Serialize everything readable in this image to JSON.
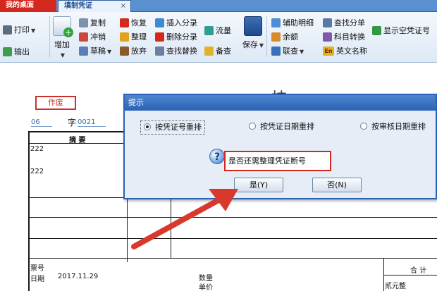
{
  "tabs": {
    "desktop": "我的桌面",
    "voucher": "填制凭证",
    "close_glyph": "×"
  },
  "toolbar": {
    "print": "打印",
    "export": "输出",
    "add": "增加",
    "copy": "复制",
    "reverse": "冲销",
    "draft": "草稿",
    "restore": "恢复",
    "organize": "整理",
    "discard": "放弃",
    "insert_entry": "插入分录",
    "delete_entry": "删除分录",
    "find_replace": "查找替换",
    "cashflow": "流量",
    "memo": "备查",
    "save": "保存",
    "aux_detail": "辅助明细",
    "balance": "余额",
    "linked_query": "联查",
    "find_entry": "查找分单",
    "subject_convert": "科目转换",
    "english_name": "英文名称",
    "show_empty_no": "显示空凭证号",
    "english_badge": "En"
  },
  "voucher": {
    "status": "作废",
    "title_partial": "技",
    "date_fragment": "06",
    "word_label": "字",
    "number": "0021",
    "summary_header": "摘 要",
    "rows": [
      "222",
      "222"
    ],
    "ticket_no_label": "票号",
    "date_label": "日期",
    "date_value": "2017.11.29",
    "quantity_label": "数量",
    "unit_price_label": "单价",
    "total_label": "合 计",
    "amount_words": "贰元整"
  },
  "dialog": {
    "title": "提示",
    "options": [
      {
        "label": "按凭证号重排",
        "selected": true
      },
      {
        "label": "按凭证日期重排",
        "selected": false
      },
      {
        "label": "按审核日期重排",
        "selected": false
      }
    ],
    "icon_glyph": "?",
    "message": "是否还需整理凭证断号",
    "yes_button": "是(Y)",
    "no_button": "否(N)"
  },
  "colors": {
    "accent_red": "#d2281e",
    "title_blue": "#2a62b7",
    "tab_blue": "#5a8fd0"
  }
}
